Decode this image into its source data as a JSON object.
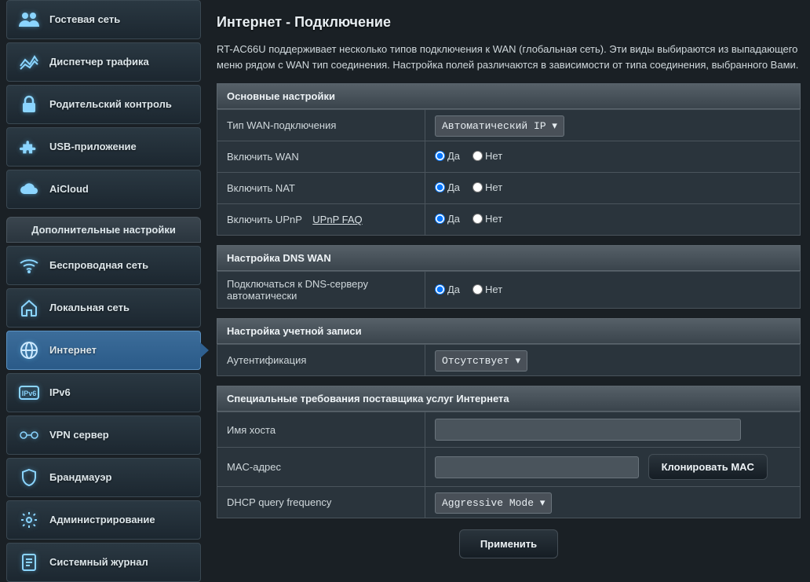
{
  "sidebar": {
    "top_items": [
      {
        "label": "Гостевая сеть",
        "icon": "guest"
      },
      {
        "label": "Диспетчер трафика",
        "icon": "traffic"
      },
      {
        "label": "Родительский контроль",
        "icon": "parental"
      },
      {
        "label": "USB-приложение",
        "icon": "usb"
      },
      {
        "label": "AiCloud",
        "icon": "cloud"
      }
    ],
    "section_title": "Дополнительные настройки",
    "adv_items": [
      {
        "label": "Беспроводная сеть",
        "icon": "wifi"
      },
      {
        "label": "Локальная сеть",
        "icon": "lan"
      },
      {
        "label": "Интернет",
        "icon": "internet",
        "active": true
      },
      {
        "label": "IPv6",
        "icon": "ipv6"
      },
      {
        "label": "VPN сервер",
        "icon": "vpn"
      },
      {
        "label": "Брандмауэр",
        "icon": "firewall"
      },
      {
        "label": "Администрирование",
        "icon": "admin"
      },
      {
        "label": "Системный журнал",
        "icon": "log"
      }
    ]
  },
  "page": {
    "title": "Интернет - Подключение",
    "description": "RT-AC66U поддерживает несколько типов подключения к WAN (глобальная сеть). Эти виды выбираются из выпадающего меню рядом с WAN тип соединения. Настройка полей различаются в зависимости от типа соединения, выбранного Вами."
  },
  "labels": {
    "yes": "Да",
    "no": "Нет"
  },
  "sections": {
    "basic": {
      "header": "Основные настройки",
      "wan_type_label": "Тип WAN-подключения",
      "wan_type_value": "Автоматический IP",
      "enable_wan_label": "Включить WAN",
      "enable_nat_label": "Включить NAT",
      "enable_upnp_label": "Включить UPnP",
      "upnp_faq": "UPnP FAQ"
    },
    "dns": {
      "header": "Настройка DNS WAN",
      "auto_dns_label": "Подключаться к DNS-серверу автоматически"
    },
    "account": {
      "header": "Настройка учетной записи",
      "auth_label": "Аутентификация",
      "auth_value": "Отсутствует"
    },
    "isp": {
      "header": "Специальные требования поставщика услуг Интернета",
      "host_label": "Имя хоста",
      "mac_label": "MAC-адрес",
      "clone_mac": "Клонировать MAC",
      "dhcp_freq_label": "DHCP query frequency",
      "dhcp_freq_value": "Aggressive Mode"
    }
  },
  "apply": "Применить"
}
